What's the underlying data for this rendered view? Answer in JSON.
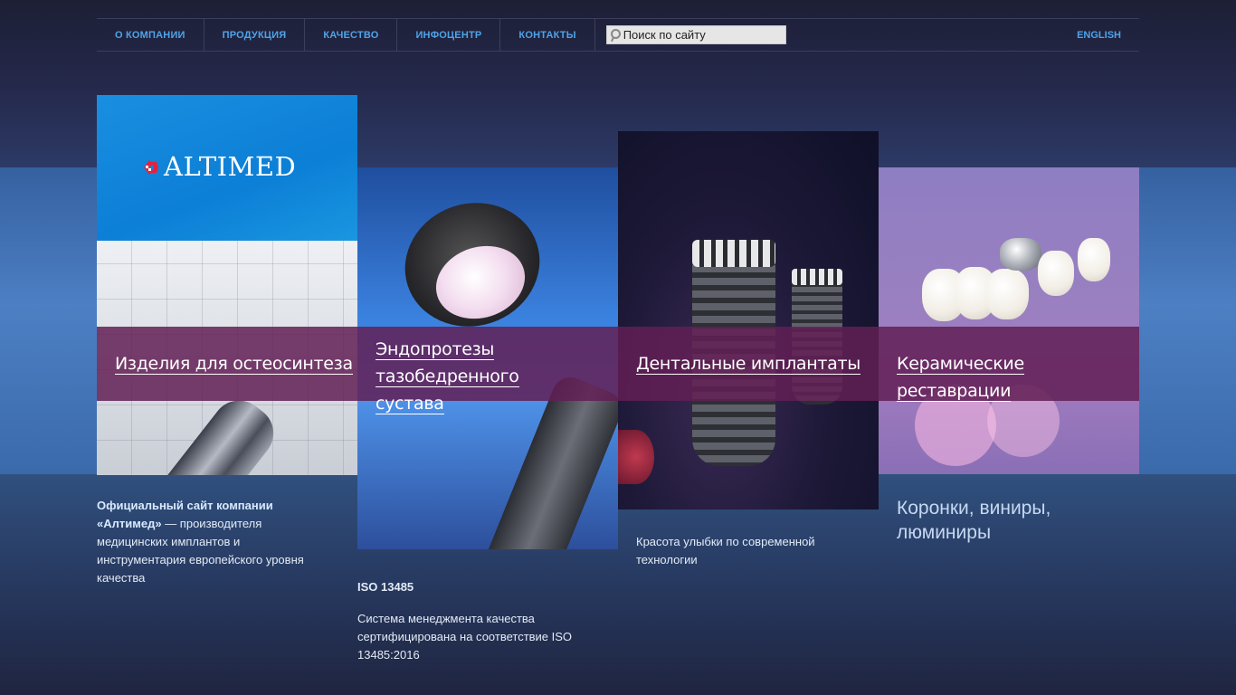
{
  "nav": {
    "items": [
      {
        "label": "О КОМПАНИИ"
      },
      {
        "label": "ПРОДУКЦИЯ"
      },
      {
        "label": "КАЧЕСТВО"
      },
      {
        "label": "ИНФОЦЕНТР"
      },
      {
        "label": "КОНТАКТЫ"
      }
    ],
    "search_placeholder": "Поиск по сайту",
    "language": "ENGLISH"
  },
  "logo": {
    "text": "ALTIMED",
    "icon": "altimed-logo-icon",
    "icon_color": "#e8203a"
  },
  "tiles": [
    {
      "label": "Изделия для остеосинтеза"
    },
    {
      "label_line1": "Эндопротезы тазобедренного",
      "label_line2": "сустава"
    },
    {
      "label": "Дентальные имплантаты"
    },
    {
      "label": "Керамические реставрации"
    }
  ],
  "intro": {
    "bold_line1": "Официальный сайт компании",
    "bold_line2": "«Алтимед»",
    "rest_line2": " — производителя",
    "line3": "медицинских имплантов и",
    "line4": "инструментария европейского уровня",
    "line5": "качества"
  },
  "iso": {
    "title": "ISO 13485",
    "line1": "Система менеджмента качества",
    "line2": "сертифицирована на соответствие ISO",
    "line3": "13485:2016"
  },
  "dental": {
    "line1": "Красота улыбки по современной",
    "line2": "технологии"
  },
  "ceramic": {
    "line1": "Коронки, виниры,",
    "line2": "люминиры"
  },
  "colors": {
    "nav_link": "#4fa3e8",
    "overlay": "#621e55",
    "logo_bg": "#0c7fd6"
  }
}
